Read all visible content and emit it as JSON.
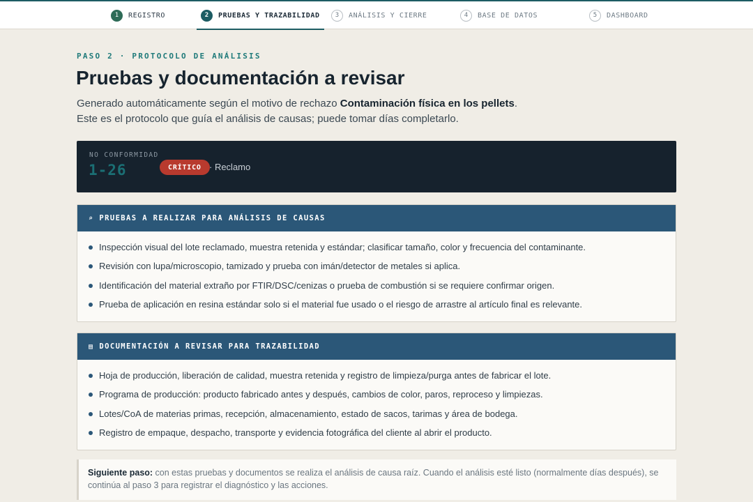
{
  "steps": [
    {
      "num": "1",
      "label": "REGISTRO",
      "state": "done"
    },
    {
      "num": "2",
      "label": "PRUEBAS Y TRAZABILIDAD",
      "state": "active"
    },
    {
      "num": "3",
      "label": "ANÁLISIS Y CIERRE",
      "state": "pending"
    },
    {
      "num": "4",
      "label": "BASE DE DATOS",
      "state": "pending"
    },
    {
      "num": "5",
      "label": "DASHBOARD",
      "state": "pending"
    }
  ],
  "header": {
    "eyebrow": "PASO 2 · PROTOCOLO DE ANÁLISIS",
    "title": "Pruebas y documentación a revisar",
    "intro_before": "Generado automáticamente según el motivo de rechazo ",
    "intro_bold": "Contaminación física en los pellets",
    "intro_after": ".",
    "intro_line2": "Este es el protocolo que guía el análisis de causas; puede tomar días completarlo."
  },
  "nonconformity": {
    "label": "NO CONFORMIDAD",
    "code": "1-26",
    "severity": "CRÍTICO",
    "type": "· Reclamo",
    "colors": {
      "background": "#16222d",
      "code": "#1b6f74",
      "badge": "#b83a2e"
    }
  },
  "tests_panel": {
    "icon": "search-icon",
    "title": "PRUEBAS A REALIZAR PARA ANÁLISIS DE CAUSAS",
    "items": [
      "Inspección visual del lote reclamado, muestra retenida y estándar; clasificar tamaño, color y frecuencia del contaminante.",
      "Revisión con lupa/microscopio, tamizado y prueba con imán/detector de metales si aplica.",
      "Identificación del material extraño por FTIR/DSC/cenizas o prueba de combustión si se requiere confirmar origen.",
      "Prueba de aplicación en resina estándar solo si el material fue usado o el riesgo de arrastre al artículo final es relevante."
    ]
  },
  "docs_panel": {
    "icon": "document-icon",
    "title": "DOCUMENTACIÓN A REVISAR PARA TRAZABILIDAD",
    "items": [
      "Hoja de producción, liberación de calidad, muestra retenida y registro de limpieza/purga antes de fabricar el lote.",
      "Programa de producción: producto fabricado antes y después, cambios de color, paros, reproceso y limpiezas.",
      "Lotes/CoA de materias primas, recepción, almacenamiento, estado de sacos, tarimas y área de bodega.",
      "Registro de empaque, despacho, transporte y evidencia fotográfica del cliente al abrir el producto."
    ]
  },
  "next_step": {
    "label": "Siguiente paso:",
    "text": " con estas pruebas y documentos se realiza el análisis de causa raíz. Cuando el análisis esté listo (normalmente días después), se continúa al paso 3 para registrar el diagnóstico y las acciones."
  },
  "colors": {
    "accent": "#1d5c63",
    "panel_header": "#2b5778",
    "page_background": "#f0ede6"
  }
}
